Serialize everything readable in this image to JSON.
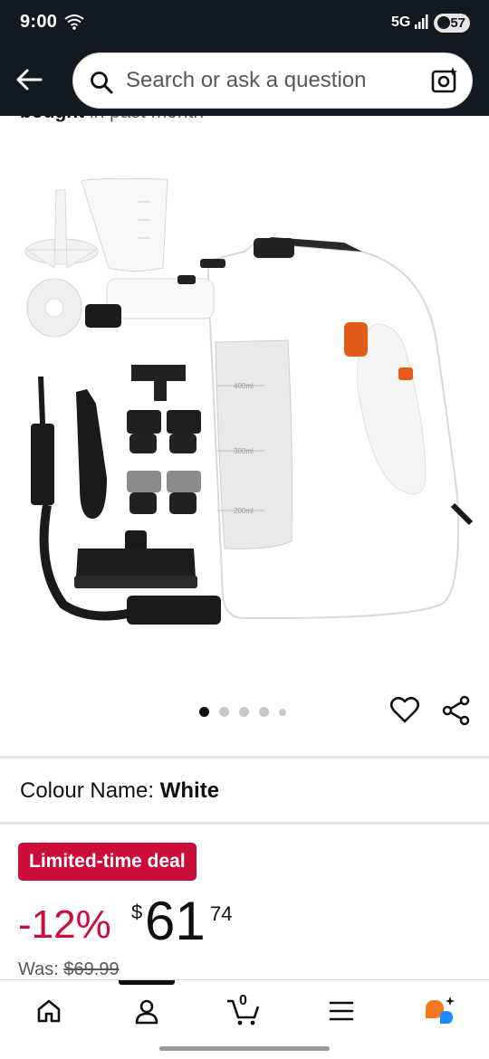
{
  "status_bar": {
    "time": "9:00",
    "network": "5G",
    "battery": "57"
  },
  "header": {
    "search_placeholder": "Search or ask a question"
  },
  "product": {
    "sales_bought": "bought",
    "sales_suffix": "in past month",
    "image_alt": "Handheld steam cleaner with accessories",
    "carousel_total": 5,
    "carousel_active": 1,
    "tank_marks": [
      "400ml",
      "300ml",
      "200ml"
    ]
  },
  "variant": {
    "label": "Colour Name:",
    "value": "White"
  },
  "deal": {
    "badge": "Limited-time deal",
    "discount": "-12%",
    "currency": "$",
    "price_whole": "61",
    "price_fraction": "74",
    "was_label": "Was:",
    "was_price": "$69.99"
  },
  "bottom_nav": {
    "cart_count": "0",
    "items": [
      "home-icon",
      "account-icon",
      "cart-icon",
      "menu-icon",
      "rufus-icon"
    ]
  },
  "colors": {
    "header_bg": "#131921",
    "deal_red": "#cc0c39",
    "text": "#0f1111",
    "muted": "#565959"
  }
}
